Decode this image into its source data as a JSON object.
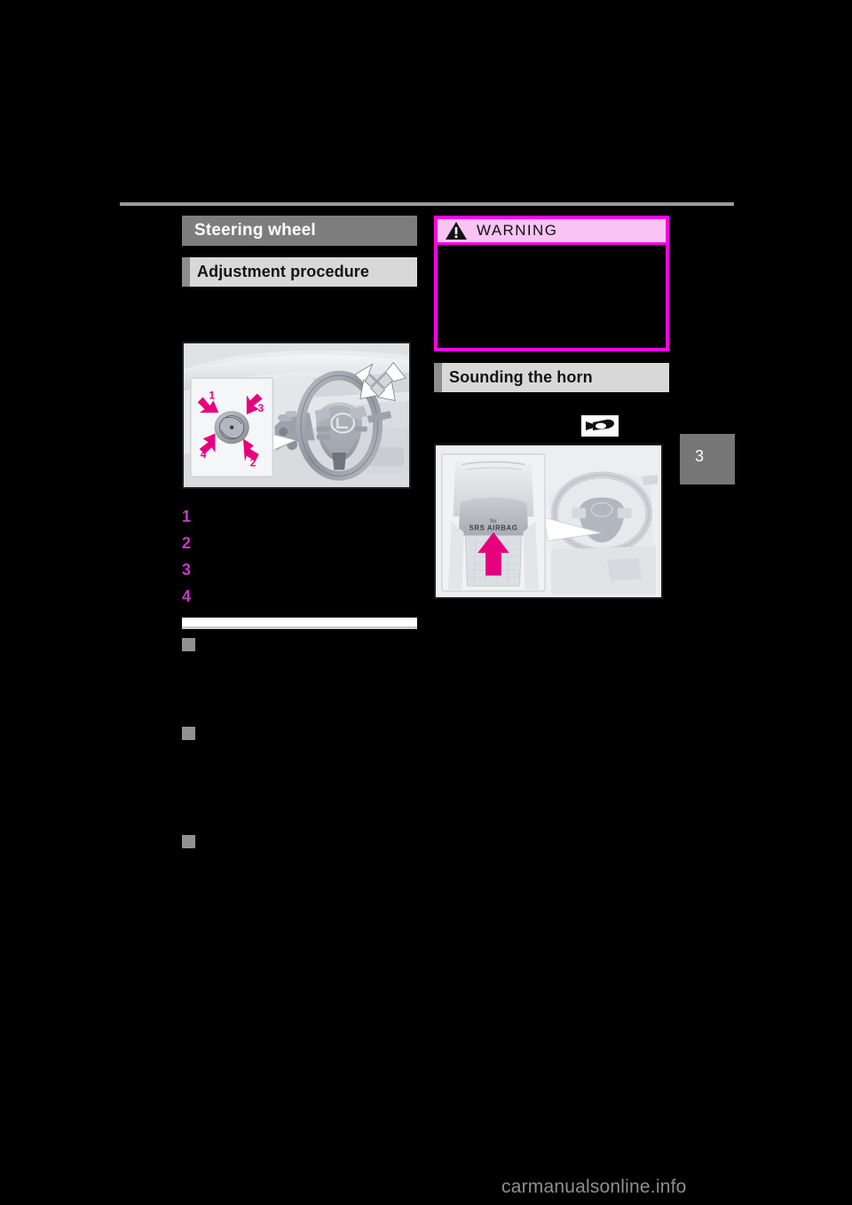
{
  "document": {
    "chapter_number": "3",
    "watermark": "carmanualsonline.info"
  },
  "left_column": {
    "section_heading": "Steering wheel",
    "subsection_heading": "Adjustment procedure",
    "figure": {
      "name": "steering-wheel-tilt-telescopic-illustration",
      "inset_labels": [
        "1",
        "2",
        "3",
        "4"
      ],
      "arrow_color": "#e6007e",
      "callout_color": "#ffffff"
    },
    "numbered_steps": [
      {
        "number": "1",
        "text": ""
      },
      {
        "number": "2",
        "text": ""
      },
      {
        "number": "3",
        "text": ""
      },
      {
        "number": "4",
        "text": ""
      }
    ],
    "subsections": [
      {
        "bullet": "square-bullet",
        "title": "",
        "body": ""
      },
      {
        "bullet": "square-bullet",
        "title": "",
        "body": ""
      },
      {
        "bullet": "square-bullet",
        "title": "",
        "body": ""
      }
    ]
  },
  "right_column": {
    "warning_box": {
      "label": "WARNING",
      "icon": "warning-triangle-icon",
      "header_bg": "#f9c4f4",
      "border_color": "#ff00e6",
      "bullet_color": "#ff00e6",
      "body_text": ""
    },
    "subsection_heading": "Sounding the horn",
    "horn_icon": "horn-icon",
    "figure": {
      "name": "horn-pad-illustration",
      "pad_label_line1": "for",
      "pad_label_line2": "SRS AIRBAG",
      "arrow_color": "#e6007e"
    }
  },
  "colors": {
    "heading_bar": "#7d7d7d",
    "subheading_bar": "#d8d8d8",
    "subheading_accent": "#8d8d8d",
    "bullet_gray": "#919191",
    "number_magenta": "#c23cc2",
    "rule_gray": "#9a9a9a",
    "tab_gray": "#767676"
  }
}
